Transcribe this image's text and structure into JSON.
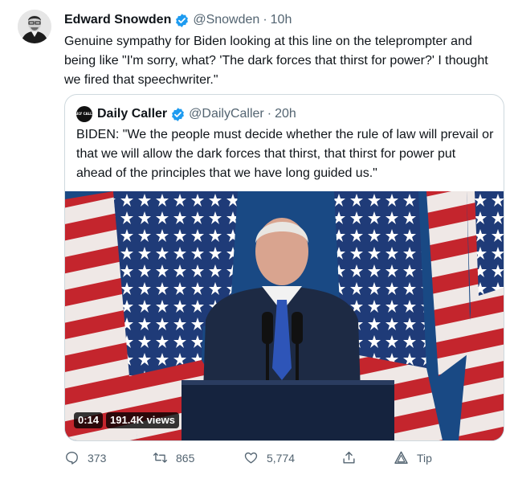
{
  "tweet": {
    "author_name": "Edward Snowden",
    "handle": "@Snowden",
    "separator": "·",
    "time": "10h",
    "text": "Genuine sympathy for Biden looking at this line on the teleprompter and being like \"I'm sorry, what? 'The dark forces that thirst for power?' I thought we fired that speechwriter.\""
  },
  "quoted": {
    "avatar_label": "DAILY CALLER",
    "author_name": "Daily Caller",
    "handle": "@DailyCaller",
    "separator": "·",
    "time": "20h",
    "text": "BIDEN: \"We the people must decide whether the rule of law will prevail or that we will allow the dark forces that thirst, that thirst for power put ahead of the principles that we have long guided us.\"",
    "video": {
      "duration": "0:14",
      "views": "191.4K views"
    }
  },
  "actions": {
    "replies": "373",
    "retweets": "865",
    "likes": "5,774",
    "tip_label": "Tip"
  },
  "colors": {
    "verified": "#1d9bf0",
    "secondary_text": "#536471",
    "border": "#cfd9de"
  },
  "icons": [
    "verified-badge-icon",
    "reply-icon",
    "retweet-icon",
    "like-icon",
    "share-icon",
    "tip-icon"
  ]
}
